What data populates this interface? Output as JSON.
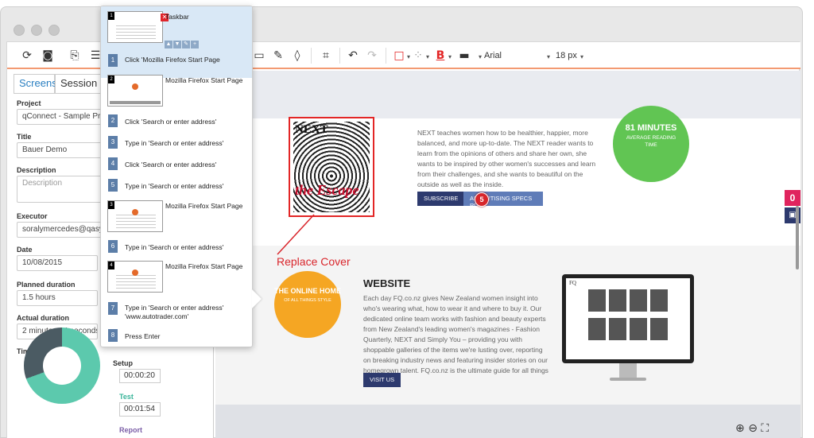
{
  "toolbar": {
    "font_name": "Arial",
    "font_size": "18 px"
  },
  "left_panel": {
    "tabs": [
      {
        "label": "Screens"
      },
      {
        "label": "Session"
      }
    ],
    "project_label": "Project",
    "project_value": "qConnect - Sample Project",
    "title_label": "Title",
    "title_value": "Bauer Demo",
    "description_label": "Description",
    "description_placeholder": "Description",
    "executor_label": "Executor",
    "executor_value": "soralymercedes@qasymphony.com",
    "date_label": "Date",
    "date_value": "10/08/2015",
    "planned_label": "Planned duration",
    "planned_value": "1.5 hours",
    "actual_label": "Actual duration",
    "actual_value": "2 minutes 14 seconds",
    "time_types_label": "Time types",
    "setup_label": "Setup",
    "setup_value": "00:00:20",
    "test_label": "Test",
    "test_value": "00:01:54",
    "report_label": "Report",
    "colors": {
      "test": "#5cc9ad",
      "setup": "#4b5b63",
      "test_label": "#3ab59a",
      "report_label": "#7b5ea7"
    }
  },
  "popup": {
    "thumbs": [
      {
        "num": "1",
        "title": "Taskbar"
      },
      {
        "num": "2",
        "title": "Mozilla Firefox Start Page"
      },
      {
        "num": "3",
        "title": "Mozilla Firefox Start Page"
      },
      {
        "num": "4",
        "title": "Mozilla Firefox Start Page"
      }
    ],
    "steps": [
      {
        "num": "1",
        "text": "Click 'Mozilla Firefox Start Page"
      },
      {
        "num": "2",
        "text": "Click 'Search or enter address'"
      },
      {
        "num": "3",
        "text": "Type in 'Search or enter address'"
      },
      {
        "num": "4",
        "text": "Click 'Search or enter address'"
      },
      {
        "num": "5",
        "text": "Type in 'Search or enter address'"
      },
      {
        "num": "6",
        "text": "Type in 'Search or enter address'"
      },
      {
        "num": "7",
        "text": "Type in 'Search or enter address' 'www.autotrader.com'"
      },
      {
        "num": "8",
        "text": "Press Enter"
      }
    ]
  },
  "canvas": {
    "cover_masthead": "NEXT",
    "cover_escape": "the Escape",
    "annotation_label": "Replace Cover",
    "next_paragraph": "NEXT teaches women how to be healthier, happier, more balanced, and more up-to-date. The NEXT reader wants to learn from the opinions of others and share her own, she wants to be inspired by other women's successes and learn from their challenges, and she wants to beautiful on the outside as well as the inside.",
    "subscribe_label": "SUBSCRIBE",
    "advertising_label": "ADVERTISING SPECS PDF",
    "marker_num": "5",
    "minutes_big": "81 MINUTES",
    "minutes_small": "AVERAGE READING TIME",
    "online_big": "THE ONLINE HOME",
    "online_small": "OF ALL THINGS STYLE",
    "website_title": "WEBSITE",
    "website_paragraph": "Each day FQ.co.nz gives New Zealand women insight into who's wearing what, how to wear it and where to buy it. Our dedicated online team works with fashion and beauty experts from New Zealand's leading women's magazines - Fashion Quarterly, NEXT and Simply You – providing you with shoppable galleries of the items we're lusting over, reporting on breaking industry news and featuring insider stories on our homegrown talent. FQ.co.nz is the ultimate guide for all things style.",
    "visit_label": "VISIT US",
    "monitor_logo": "FQ",
    "side_badge_num": "0"
  }
}
